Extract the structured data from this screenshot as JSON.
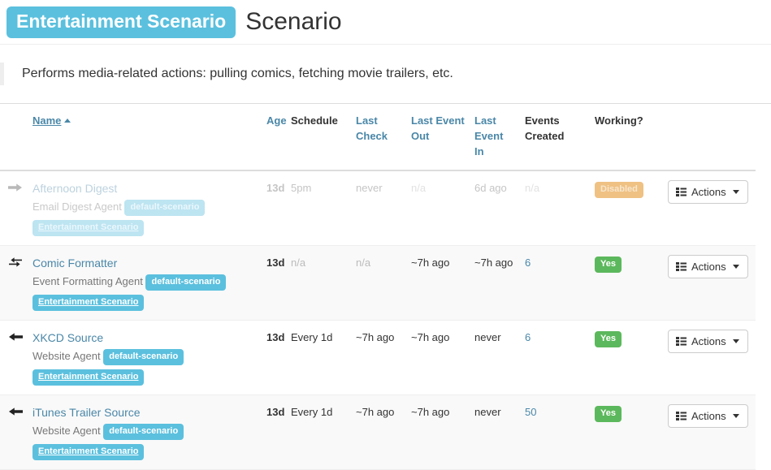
{
  "header": {
    "scenario_badge": "Entertainment Scenario",
    "title": "Scenario"
  },
  "description": "Performs media-related actions: pulling comics, fetching movie trailers, etc.",
  "table": {
    "columns": [
      {
        "key": "icon",
        "label": "",
        "link": false
      },
      {
        "key": "name",
        "label": "Name",
        "link": true,
        "sorted": "asc"
      },
      {
        "key": "age",
        "label": "Age",
        "link": true
      },
      {
        "key": "sched",
        "label": "Schedule",
        "link": false
      },
      {
        "key": "lcheck",
        "label": "Last Check",
        "link": true
      },
      {
        "key": "lout",
        "label": "Last Event Out",
        "link": true
      },
      {
        "key": "lin",
        "label": "Last Event In",
        "link": true
      },
      {
        "key": "events",
        "label": "Events Created",
        "link": false
      },
      {
        "key": "working",
        "label": "Working?",
        "link": false
      },
      {
        "key": "actions",
        "label": "",
        "link": false
      }
    ],
    "actions_label": "Actions",
    "rows": [
      {
        "icon": "arrow-right-icon",
        "name": "Afternoon Digest",
        "type": "Email Digest Agent",
        "type_badge": "default-scenario",
        "scenario_tag": "Entertainment Scenario",
        "age": "13d",
        "schedule": "5pm",
        "last_check": "never",
        "last_event_out": "n/a",
        "last_event_in": "6d ago",
        "events_created": "n/a",
        "working": "Disabled",
        "working_color": "#f0ad4e",
        "actions": "Actions"
      },
      {
        "icon": "arrows-exchange-icon",
        "name": "Comic Formatter",
        "type": "Event Formatting Agent",
        "type_badge": "default-scenario",
        "scenario_tag": "Entertainment Scenario",
        "age": "13d",
        "schedule": "n/a",
        "last_check": "n/a",
        "last_event_out": "~7h ago",
        "last_event_in": "~7h ago",
        "events_created": "6",
        "working": "Yes",
        "working_color": "#5cb85c",
        "actions": "Actions"
      },
      {
        "icon": "arrow-left-icon",
        "name": "XKCD Source",
        "type": "Website Agent",
        "type_badge": "default-scenario",
        "scenario_tag": "Entertainment Scenario",
        "age": "13d",
        "schedule": "Every 1d",
        "last_check": "~7h ago",
        "last_event_out": "~7h ago",
        "last_event_in": "never",
        "events_created": "6",
        "working": "Yes",
        "working_color": "#5cb85c",
        "actions": "Actions"
      },
      {
        "icon": "arrow-left-icon",
        "name": "iTunes Trailer Source",
        "type": "Website Agent",
        "type_badge": "default-scenario",
        "scenario_tag": "Entertainment Scenario",
        "age": "13d",
        "schedule": "Every 1d",
        "last_check": "~7h ago",
        "last_event_out": "~7h ago",
        "last_event_in": "never",
        "events_created": "50",
        "working": "Yes",
        "working_color": "#5cb85c",
        "actions": "Actions"
      }
    ]
  },
  "colors": {
    "accent_blue": "#5bc0de",
    "link_blue": "#4a87a8",
    "success_green": "#5cb85c",
    "warning_orange": "#f0ad4e",
    "muted_gray": "#bbbbbb"
  }
}
